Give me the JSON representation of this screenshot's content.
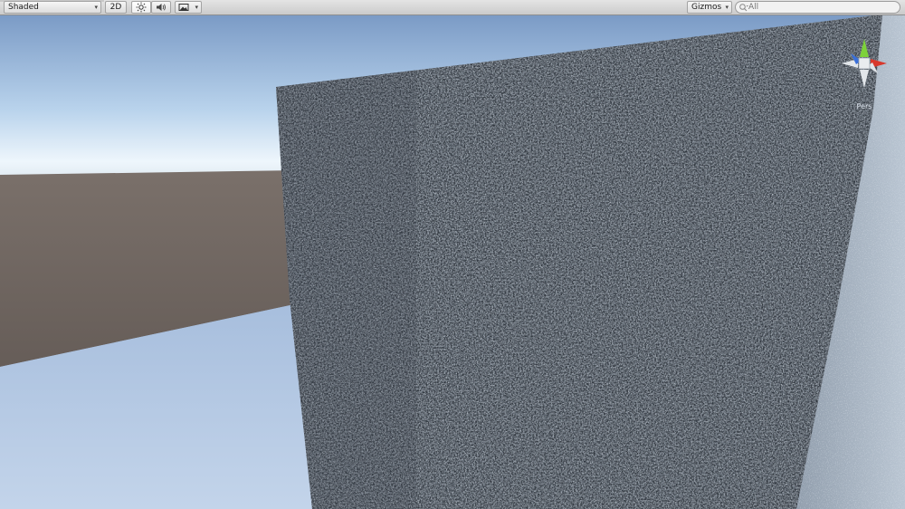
{
  "toolbar": {
    "shading_mode": "Shaded",
    "mode_2d_label": "2D",
    "gizmos_label": "Gizmos",
    "search_placeholder": "All"
  },
  "icons": {
    "lighting": "sun-icon",
    "audio": "speaker-icon",
    "effects": "image-icon",
    "search": "magnifier-icon",
    "orientation": "scene-gizmo-icon"
  },
  "scene": {
    "camera_label": "Pers",
    "colors": {
      "sky_top": "#7f9fc9",
      "sky_horizon": "#e6f2fb",
      "ground": "#6f6661",
      "floor": "#b6c9e4",
      "wall": "#8a939d",
      "gizmo_x": "#d8382c",
      "gizmo_y": "#7dd23a",
      "gizmo_z": "#3a6fd8"
    }
  }
}
